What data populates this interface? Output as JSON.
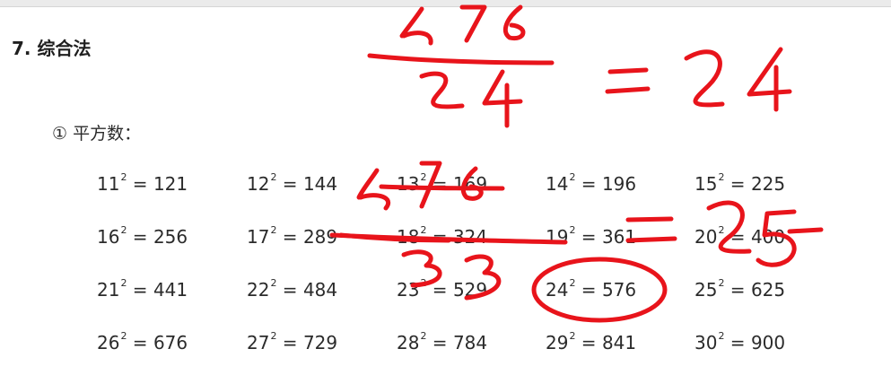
{
  "section": {
    "title": "7. 综合法"
  },
  "subsection": {
    "title": "① 平方数："
  },
  "squares": [
    {
      "base": "11",
      "exp": "2",
      "result": "121"
    },
    {
      "base": "12",
      "exp": "2",
      "result": "144"
    },
    {
      "base": "13",
      "exp": "2",
      "result": "169"
    },
    {
      "base": "14",
      "exp": "2",
      "result": "196"
    },
    {
      "base": "15",
      "exp": "2",
      "result": "225"
    },
    {
      "base": "16",
      "exp": "2",
      "result": "256"
    },
    {
      "base": "17",
      "exp": "2",
      "result": "289"
    },
    {
      "base": "18",
      "exp": "2",
      "result": "324"
    },
    {
      "base": "19",
      "exp": "2",
      "result": "361"
    },
    {
      "base": "20",
      "exp": "2",
      "result": "400"
    },
    {
      "base": "21",
      "exp": "2",
      "result": "441"
    },
    {
      "base": "22",
      "exp": "2",
      "result": "484"
    },
    {
      "base": "23",
      "exp": "2",
      "result": "529"
    },
    {
      "base": "24",
      "exp": "2",
      "result": "576"
    },
    {
      "base": "25",
      "exp": "2",
      "result": "625"
    },
    {
      "base": "26",
      "exp": "2",
      "result": "676"
    },
    {
      "base": "27",
      "exp": "2",
      "result": "729"
    },
    {
      "base": "28",
      "exp": "2",
      "result": "784"
    },
    {
      "base": "29",
      "exp": "2",
      "result": "841"
    },
    {
      "base": "30",
      "exp": "2",
      "result": "900"
    }
  ],
  "handwriting": {
    "color": "#e8141b",
    "note": "576 ÷ 24 = 24 ; 576 ÷ 23 = 25 (handwritten, circled 24² = 576)"
  }
}
